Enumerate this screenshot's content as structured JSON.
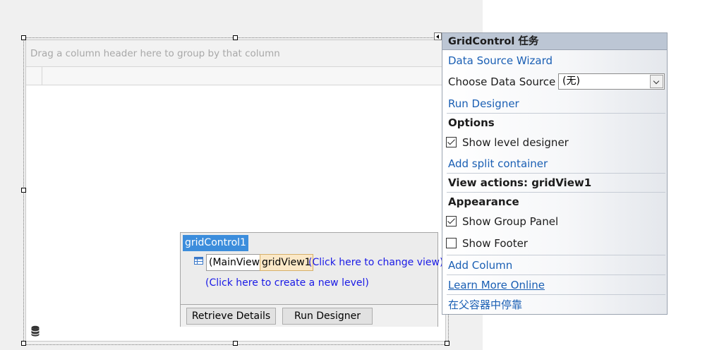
{
  "grid": {
    "group_panel_text": "Drag a column header here to group by that column"
  },
  "level_designer": {
    "title": "gridControl1",
    "main_view": "(MainView)",
    "view_name": "gridView1",
    "change_view_link": "(Click here to change view)",
    "create_level_link": "(Click here to create a new level)",
    "retrieve_details_button": "Retrieve Details",
    "run_designer_button": "Run Designer"
  },
  "task_panel": {
    "title": "GridControl 任务",
    "data_source_wizard": "Data Source Wizard",
    "choose_data_source_label": "Choose Data Source",
    "choose_data_source_value": "(无)",
    "run_designer": "Run Designer",
    "options_heading": "Options",
    "show_level_designer": {
      "label": "Show level designer",
      "checked": true
    },
    "add_split_container": "Add split container",
    "view_actions_heading": "View actions: gridView1",
    "appearance_heading": "Appearance",
    "show_group_panel": {
      "label": "Show Group Panel",
      "checked": true
    },
    "show_footer": {
      "label": "Show Footer",
      "checked": false
    },
    "add_column": "Add Column",
    "learn_more_online": "Learn More Online",
    "dock_in_parent": "在父容器中停靠"
  },
  "colors": {
    "selection_blue": "#3c8ddc",
    "link_blue": "#1a5fb4",
    "panel_header": "#bcc6d4"
  }
}
